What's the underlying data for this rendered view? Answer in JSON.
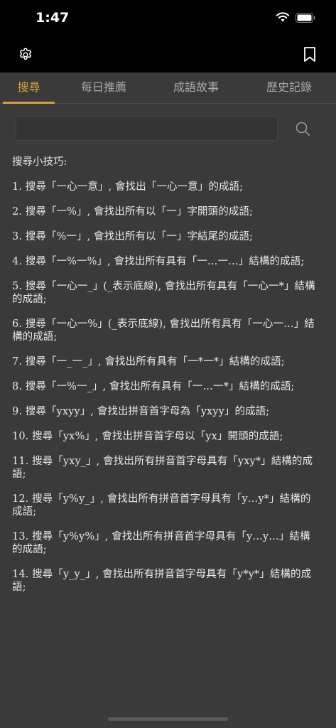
{
  "status": {
    "time": "1:47"
  },
  "nav": {
    "settings_icon": "gear-icon",
    "bookmark_icon": "bookmark-icon"
  },
  "tabs": [
    {
      "label": "搜尋",
      "active": true
    },
    {
      "label": "每日推薦",
      "active": false
    },
    {
      "label": "成語故事",
      "active": false
    },
    {
      "label": "歷史記錄",
      "active": false
    }
  ],
  "search": {
    "value": "",
    "placeholder": "",
    "icon": "search-icon"
  },
  "tips": {
    "title": "搜尋小技巧:",
    "items": [
      "1. 搜尋「一心一意」, 會找出「一心一意」的成語;",
      "2. 搜尋「一%」, 會找出所有以「一」字開頭的成語;",
      "3. 搜尋「%一」, 會找出所有以「一」字結尾的成語;",
      "4. 搜尋「一%一%」, 會找出所有具有「一…一…」結構的成語;",
      "5. 搜尋「一心一_」(_表示底線), 會找出所有具有「一心一*」結構的成語;",
      "6. 搜尋「一心一%」(_表示底線), 會找出所有具有「一心一…」結構的成語;",
      "7. 搜尋「一_一_」, 會找出所有具有「一*一*」結構的成語;",
      "8. 搜尋「一%一_」, 會找出所有具有「一…一*」結構的成語;",
      "9. 搜尋「yxyy」, 會找出拼音首字母為「yxyy」的成語;",
      "10. 搜尋「yx%」, 會找出拼音首字母以「yx」開頭的成語;",
      "11. 搜尋「yxy_」, 會找出所有拼音首字母具有「yxy*」結構的成語;",
      "12. 搜尋「y%y_」, 會找出所有拼音首字母具有「y…y*」結構的成語;",
      "13. 搜尋「y%y%」, 會找出所有拼音首字母具有「y…y…」結構的成語;",
      "14. 搜尋「y_y_」, 會找出所有拼音首字母具有「y*y*」結構的成語;"
    ]
  },
  "colors": {
    "accent": "#d4a23c",
    "background": "#3a3a3a",
    "bar": "#000000"
  }
}
